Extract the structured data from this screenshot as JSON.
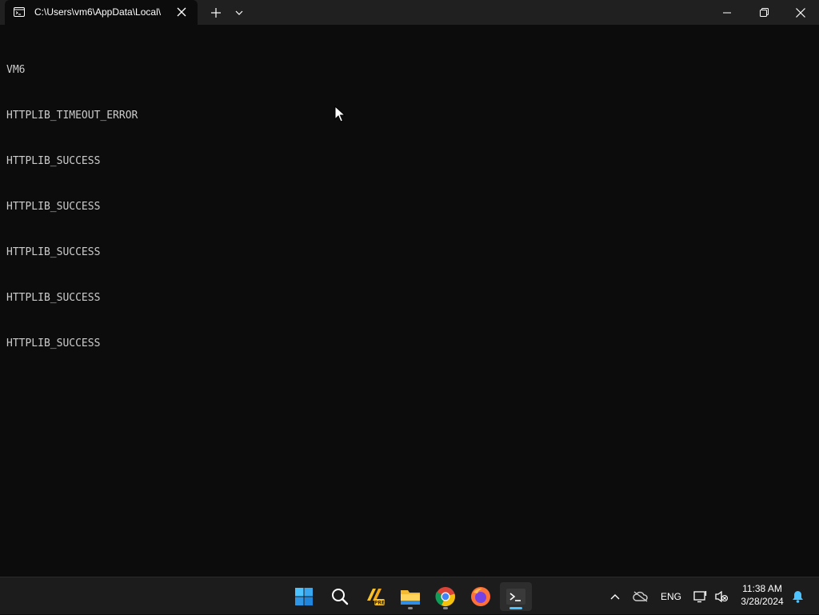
{
  "window": {
    "tab_title": "C:\\Users\\vm6\\AppData\\Local\\",
    "tab_icon": "terminal-icon"
  },
  "terminal": {
    "lines": [
      "VM6",
      "HTTPLIB_TIMEOUT_ERROR",
      "HTTPLIB_SUCCESS",
      "HTTPLIB_SUCCESS",
      "HTTPLIB_SUCCESS",
      "HTTPLIB_SUCCESS",
      "HTTPLIB_SUCCESS"
    ]
  },
  "taskbar": {
    "apps": [
      "start-icon",
      "search-icon",
      "pre-release-app-icon",
      "file-explorer-icon",
      "chrome-icon",
      "firefox-icon",
      "terminal-icon"
    ],
    "tray": {
      "language": "ENG",
      "time": "11:38 AM",
      "date": "3/28/2024"
    }
  },
  "colors": {
    "terminal_bg": "#0c0c0c",
    "terminal_fg": "#cccccc",
    "titlebar_bg": "#202020",
    "taskbar_bg": "#1c1c1c",
    "accent": "#4cc2ff"
  }
}
